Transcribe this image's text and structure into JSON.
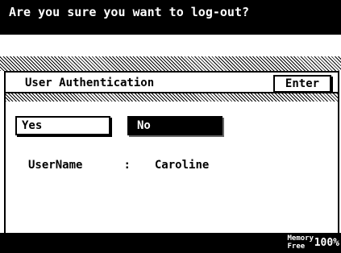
{
  "header": {
    "prompt": "Are you sure you want to log-out?"
  },
  "panel": {
    "title": "User Authentication",
    "enter_label": "Enter"
  },
  "choices": {
    "yes_label": "Yes",
    "no_label": "No",
    "selected": "No"
  },
  "user": {
    "label": "UserName",
    "separator": ":",
    "value": "Caroline"
  },
  "footer": {
    "memory_label_line1": "Memory",
    "memory_label_line2": "Free",
    "memory_value": "100%"
  },
  "colors": {
    "background": "#ffffff",
    "foreground": "#000000",
    "selected_bg": "#000000",
    "selected_fg": "#ffffff"
  }
}
